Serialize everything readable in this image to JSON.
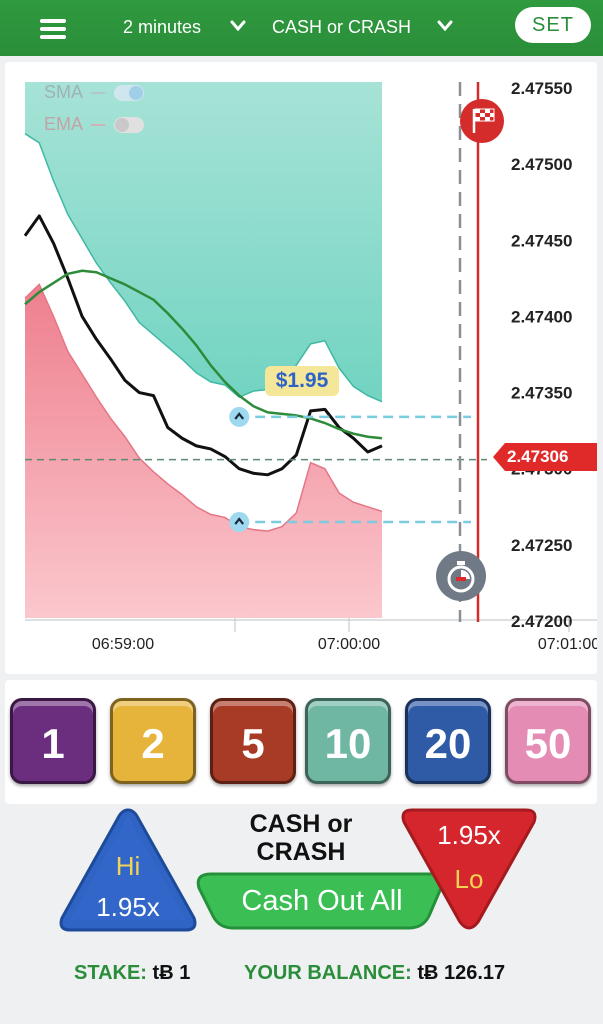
{
  "topbar": {
    "duration": "2 minutes",
    "mode": "CASH or CRASH",
    "set_label": "SET"
  },
  "indicators": [
    {
      "label": "SMA",
      "enabled": true
    },
    {
      "label": "EMA",
      "enabled": false
    }
  ],
  "chart_data": {
    "type": "line",
    "x_ticks": [
      "06:59:00",
      "07:00:00",
      "07:01:00"
    ],
    "y_ticks": [
      "2.47550",
      "2.47500",
      "2.47450",
      "2.47400",
      "2.47350",
      "2.47300",
      "2.47250",
      "2.47200"
    ],
    "ylim": [
      2.472,
      2.4755
    ],
    "current_price": "2.47306",
    "bet_value": "$1.95",
    "series": [
      {
        "name": "price",
        "color": "#111111",
        "values": [
          2.47453,
          2.47466,
          2.47448,
          2.47425,
          2.474,
          2.47385,
          2.47372,
          2.47358,
          2.4735,
          2.47348,
          2.47327,
          2.4732,
          2.47315,
          2.47313,
          2.47308,
          2.473,
          2.47297,
          2.47296,
          2.473,
          2.47309,
          2.47338,
          2.47339,
          2.47327,
          2.4732,
          2.47311,
          2.47315
        ]
      },
      {
        "name": "moving average",
        "color": "#2e8b3a",
        "values": [
          2.47408,
          2.47416,
          2.47422,
          2.47428,
          2.4743,
          2.47429,
          2.47425,
          2.47421,
          2.47416,
          2.47411,
          2.47402,
          2.47392,
          2.47381,
          2.47368,
          2.47357,
          2.47348,
          2.47341,
          2.47337,
          2.47336,
          2.47335,
          2.47333,
          2.4733,
          2.47326,
          2.47323,
          2.47321,
          2.4732
        ]
      }
    ],
    "upper_band": [
      2.4752,
      2.47514,
      2.47489,
      2.47467,
      2.47451,
      2.47435,
      2.47422,
      2.4741,
      2.47396,
      2.47388,
      2.4738,
      2.47372,
      2.47363,
      2.47357,
      2.47355,
      2.47347,
      2.47351,
      2.47352,
      2.47356,
      2.47368,
      2.47382,
      2.47384,
      2.47366,
      2.47354,
      2.47348,
      2.47344
    ],
    "lower_band": [
      2.47412,
      2.47421,
      2.474,
      2.47377,
      2.47362,
      2.47347,
      2.47333,
      2.47321,
      2.47307,
      2.47298,
      2.4729,
      2.47283,
      2.47275,
      2.4727,
      2.47268,
      2.47262,
      2.4726,
      2.47259,
      2.47262,
      2.47271,
      2.47304,
      2.473,
      2.47284,
      2.47278,
      2.47275,
      2.47272
    ],
    "upper_target": 2.47334,
    "lower_target": 2.47265
  },
  "chips": [
    {
      "label": "1",
      "color": "#6b2d7d"
    },
    {
      "label": "2",
      "color": "#e6b43b"
    },
    {
      "label": "5",
      "color": "#a83b25"
    },
    {
      "label": "10",
      "color": "#6fb6a3"
    },
    {
      "label": "20",
      "color": "#2e5aa6"
    },
    {
      "label": "50",
      "color": "#e58cb5"
    }
  ],
  "controls": {
    "hi_label": "Hi",
    "hi_payout": "1.95x",
    "lo_label": "Lo",
    "lo_payout": "1.95x",
    "title_line1": "CASH or",
    "title_line2": "CRASH",
    "cashout_label": "Cash Out All"
  },
  "footer": {
    "stake_label": "STAKE:",
    "stake_value": "tɃ 1",
    "balance_label": "YOUR BALANCE:",
    "balance_value": "tɃ 126.17"
  },
  "icons": {
    "finish": "checkered-flag-icon",
    "timer": "stopwatch-icon",
    "menu": "hamburger-menu-icon"
  }
}
